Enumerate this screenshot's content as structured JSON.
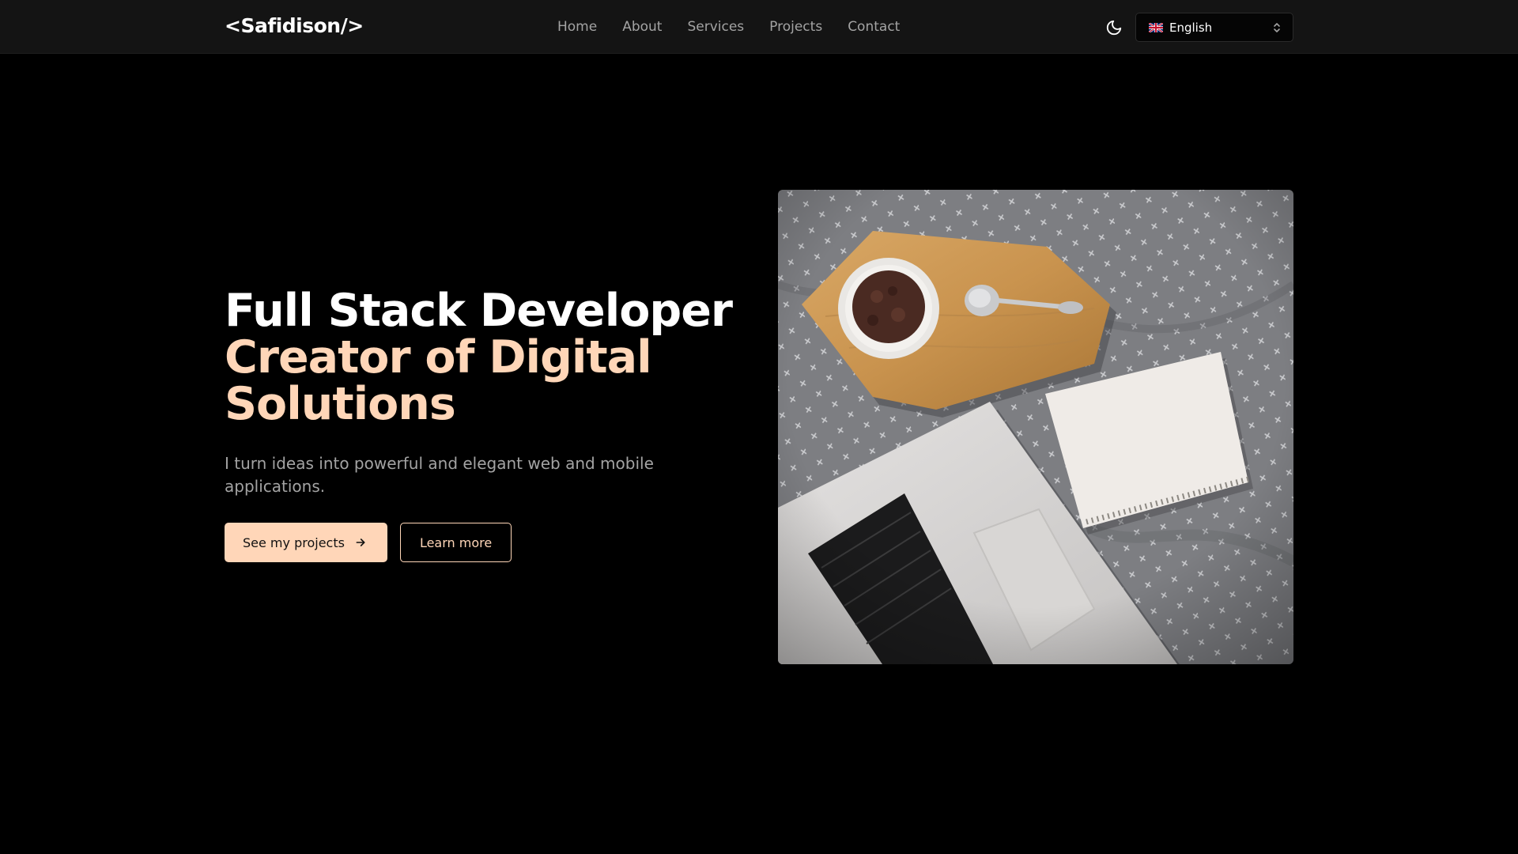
{
  "header": {
    "logo": "<Safidison/>",
    "nav": [
      {
        "label": "Home"
      },
      {
        "label": "About"
      },
      {
        "label": "Services"
      },
      {
        "label": "Projects"
      },
      {
        "label": "Contact"
      }
    ],
    "theme_toggle_icon": "moon-icon",
    "language": {
      "flag_icon": "uk-flag-icon",
      "selected": "English",
      "chevron_icon": "chevron-up-down-icon"
    }
  },
  "hero": {
    "title_line1": "Full Stack Developer",
    "title_line2": "Creator of Digital Solutions",
    "subtitle": "I turn ideas into powerful and elegant web and mobile applications.",
    "primary_button": "See my projects",
    "primary_button_icon": "arrow-right-icon",
    "secondary_button": "Learn more",
    "image_alt": "Laptop, notebook and bowl on a grey blanket"
  },
  "colors": {
    "background": "#000000",
    "header_bg": "#141414",
    "accent": "#ffd6b8",
    "muted_text": "#a3a3a3"
  }
}
